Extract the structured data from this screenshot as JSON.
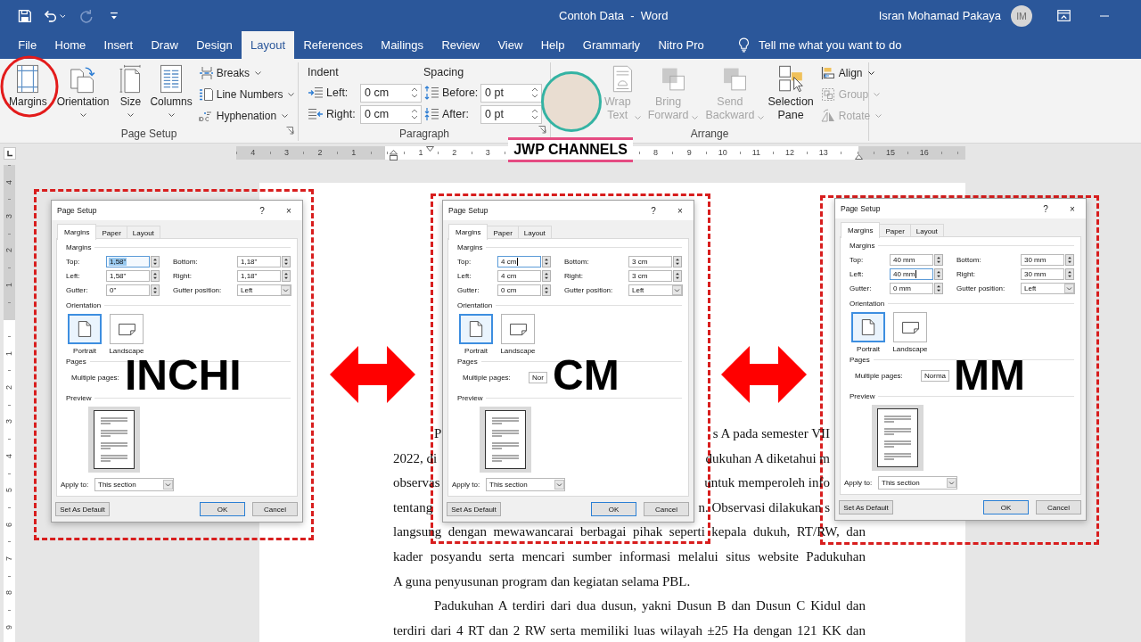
{
  "title_bar": {
    "quick_access": [
      {
        "disabled": false
      },
      {
        "disabled": false
      },
      {
        "disabled": true
      },
      {
        "disabled": false
      }
    ],
    "title": "Contoh Data  -  Word",
    "user_name": "Isran Mohamad Pakaya",
    "avatar_initials": "IM"
  },
  "ribbon_tabs": [
    {
      "label": "File",
      "selected": false
    },
    {
      "label": "Home",
      "selected": false
    },
    {
      "label": "Insert",
      "selected": false
    },
    {
      "label": "Draw",
      "selected": false
    },
    {
      "label": "Design",
      "selected": false
    },
    {
      "label": "Layout",
      "selected": true
    },
    {
      "label": "References",
      "selected": false
    },
    {
      "label": "Mailings",
      "selected": false
    },
    {
      "label": "Review",
      "selected": false
    },
    {
      "label": "View",
      "selected": false
    },
    {
      "label": "Help",
      "selected": false
    },
    {
      "label": "Grammarly",
      "selected": false
    },
    {
      "label": "Nitro Pro",
      "selected": false
    }
  ],
  "tell_me": {
    "placeholder": "Tell me what you want to do"
  },
  "ribbon": {
    "page_setup": {
      "label": "Page Setup",
      "large_buttons": [
        {
          "label": "Margins",
          "dropdown": false
        },
        {
          "label": "Orientation",
          "dropdown": true
        },
        {
          "label": "Size",
          "dropdown": true
        },
        {
          "label": "Columns",
          "dropdown": true
        }
      ],
      "small_buttons": [
        {
          "label": "Breaks"
        },
        {
          "label": "Line Numbers"
        },
        {
          "label": "Hyphenation"
        }
      ]
    },
    "paragraph": {
      "label": "Paragraph",
      "indent": {
        "heading": "Indent",
        "rows": [
          {
            "label": "Left:",
            "value": "0 cm"
          },
          {
            "label": "Right:",
            "value": "0 cm"
          }
        ]
      },
      "spacing": {
        "heading": "Spacing",
        "rows": [
          {
            "label": "Before:",
            "value": "0 pt"
          },
          {
            "label": "After:",
            "value": "0 pt"
          }
        ]
      }
    },
    "arrange": {
      "label": "Arrange",
      "large_buttons": [
        {
          "label": "Wrap Text",
          "disabled": true,
          "dropdown": true
        },
        {
          "label": "Bring Forward",
          "disabled": true,
          "dropdown": true
        },
        {
          "label": "Send Backward",
          "disabled": true,
          "dropdown": true
        },
        {
          "label": "Selection Pane",
          "disabled": false,
          "dropdown": false
        }
      ],
      "small_buttons": [
        {
          "label": "Align",
          "disabled": false
        },
        {
          "label": "Group",
          "disabled": true
        },
        {
          "label": "Rotate",
          "disabled": true
        }
      ]
    }
  },
  "ruler": {
    "before_zero": [
      "4",
      "3",
      "2",
      "1"
    ],
    "after_zero": [
      "1",
      "2",
      "3"
    ],
    "after_logo": [
      "8",
      "9",
      "10",
      "11",
      "12",
      "13"
    ],
    "after_marker": [
      "15",
      "16"
    ]
  },
  "vertical_ruler": {
    "before_zero": [
      "4",
      "3",
      "2",
      "1"
    ],
    "after_zero": [
      "1",
      "2",
      "3",
      "4",
      "5",
      "6",
      "7",
      "8",
      "9"
    ]
  },
  "document": {
    "lines": [
      {
        "kind": "split",
        "indent": true,
        "left": "P",
        "right": "s A pada semester VII"
      },
      {
        "kind": "split",
        "indent": false,
        "left": "2022, di",
        "right": "dukuhan A diketahui m"
      },
      {
        "kind": "split",
        "indent": false,
        "left": "observas",
        "right": "untuk memperoleh info"
      },
      {
        "kind": "split",
        "indent": false,
        "left": "tentang",
        "right": "n. Observasi dilakukan s"
      },
      {
        "kind": "full",
        "indent": false,
        "text": "langsung dengan mewawancarai berbagai pihak seperti kepala dukuh, RT/RW, dan"
      },
      {
        "kind": "full",
        "indent": false,
        "text": "kader posyandu serta mencari sumber informasi melalui situs website Padukuhan"
      },
      {
        "kind": "last",
        "indent": false,
        "text": "A guna penyusunan program dan kegiatan selama PBL."
      },
      {
        "kind": "full",
        "indent": true,
        "text": "Padukuhan A terdiri dari dua dusun, yakni Dusun B dan Dusun C Kidul dan"
      },
      {
        "kind": "full",
        "indent": false,
        "text": "terdiri dari 4 RT dan 2 RW serta memiliki luas wilayah ±25 Ha dengan 121 KK dan"
      }
    ]
  },
  "dialogs": [
    {
      "title": "Page Setup",
      "help_glyph": "?",
      "close_glyph": "×",
      "tabs": [
        {
          "label": "Margins",
          "selected": true
        },
        {
          "label": "Paper",
          "selected": false
        },
        {
          "label": "Layout",
          "selected": false
        }
      ],
      "margins_heading": "Margins",
      "fields": [
        {
          "label": "Top:",
          "value": "1,58\"",
          "text_selected": true,
          "cursor": false
        },
        {
          "label": "Bottom:",
          "value": "1,18\"",
          "text_selected": false,
          "cursor": false
        },
        {
          "label": "Left:",
          "value": "1,58\"",
          "text_selected": false,
          "cursor": false
        },
        {
          "label": "Right:",
          "value": "1,18\"",
          "text_selected": false,
          "cursor": false
        },
        {
          "label": "Gutter:",
          "value": "0\"",
          "text_selected": false,
          "cursor": false
        }
      ],
      "gutter_position": {
        "label": "Gutter position:",
        "value": "Left"
      },
      "orientation_heading": "Orientation",
      "orientations": [
        {
          "label": "Portrait",
          "selected": true
        },
        {
          "label": "Landscape",
          "selected": false
        }
      ],
      "pages_heading": "Pages",
      "multiple_pages": {
        "label": "Multiple pages:"
      },
      "preview_heading": "Preview",
      "apply_to": {
        "label": "Apply to:",
        "value": "This section"
      },
      "buttons": [
        {
          "label": "Set As Default",
          "default": false
        },
        {
          "label": "OK",
          "default": true
        },
        {
          "label": "Cancel",
          "default": false
        }
      ],
      "unit_label": "INCHI"
    },
    {
      "title": "Page Setup",
      "help_glyph": "?",
      "close_glyph": "×",
      "tabs": [
        {
          "label": "Margins",
          "selected": true
        },
        {
          "label": "Paper",
          "selected": false
        },
        {
          "label": "Layout",
          "selected": false
        }
      ],
      "margins_heading": "Margins",
      "fields": [
        {
          "label": "Top:",
          "value": "4 cm",
          "text_selected": false,
          "cursor": true
        },
        {
          "label": "Bottom:",
          "value": "3 cm",
          "text_selected": false,
          "cursor": false
        },
        {
          "label": "Left:",
          "value": "4 cm",
          "text_selected": false,
          "cursor": false
        },
        {
          "label": "Right:",
          "value": "3 cm",
          "text_selected": false,
          "cursor": false
        },
        {
          "label": "Gutter:",
          "value": "0 cm",
          "text_selected": false,
          "cursor": false
        }
      ],
      "gutter_position": {
        "label": "Gutter position:",
        "value": "Left"
      },
      "orientation_heading": "Orientation",
      "orientations": [
        {
          "label": "Portrait",
          "selected": true
        },
        {
          "label": "Landscape",
          "selected": false
        }
      ],
      "pages_heading": "Pages",
      "multiple_pages": {
        "label": "Multiple pages:",
        "value": "Nor"
      },
      "preview_heading": "Preview",
      "apply_to": {
        "label": "Apply to:",
        "value": "This section"
      },
      "buttons": [
        {
          "label": "Set As Default",
          "default": false
        },
        {
          "label": "OK",
          "default": true
        },
        {
          "label": "Cancel",
          "default": false
        }
      ],
      "unit_label": "CM"
    },
    {
      "title": "Page Setup",
      "help_glyph": "?",
      "close_glyph": "×",
      "tabs": [
        {
          "label": "Margins",
          "selected": true
        },
        {
          "label": "Paper",
          "selected": false
        },
        {
          "label": "Layout",
          "selected": false
        }
      ],
      "margins_heading": "Margins",
      "fields": [
        {
          "label": "Top:",
          "value": "40 mm",
          "text_selected": false,
          "cursor": false
        },
        {
          "label": "Bottom:",
          "value": "30 mm",
          "text_selected": false,
          "cursor": false
        },
        {
          "label": "Left:",
          "value": "40 mm",
          "text_selected": false,
          "cursor": true
        },
        {
          "label": "Right:",
          "value": "30 mm",
          "text_selected": false,
          "cursor": false
        },
        {
          "label": "Gutter:",
          "value": "0 mm",
          "text_selected": false,
          "cursor": false
        }
      ],
      "gutter_position": {
        "label": "Gutter position:",
        "value": "Left"
      },
      "orientation_heading": "Orientation",
      "orientations": [
        {
          "label": "Portrait",
          "selected": true
        },
        {
          "label": "Landscape",
          "selected": false
        }
      ],
      "pages_heading": "Pages",
      "multiple_pages": {
        "label": "Multiple pages:",
        "value": "Norma"
      },
      "preview_heading": "Preview",
      "apply_to": {
        "label": "Apply to:",
        "value": "This section"
      },
      "buttons": [
        {
          "label": "Set As Default",
          "default": false
        },
        {
          "label": "OK",
          "default": true
        },
        {
          "label": "Cancel",
          "default": false
        }
      ],
      "unit_label": "MM"
    }
  ],
  "branding": {
    "logo_text": "JWP CHANNELS"
  }
}
